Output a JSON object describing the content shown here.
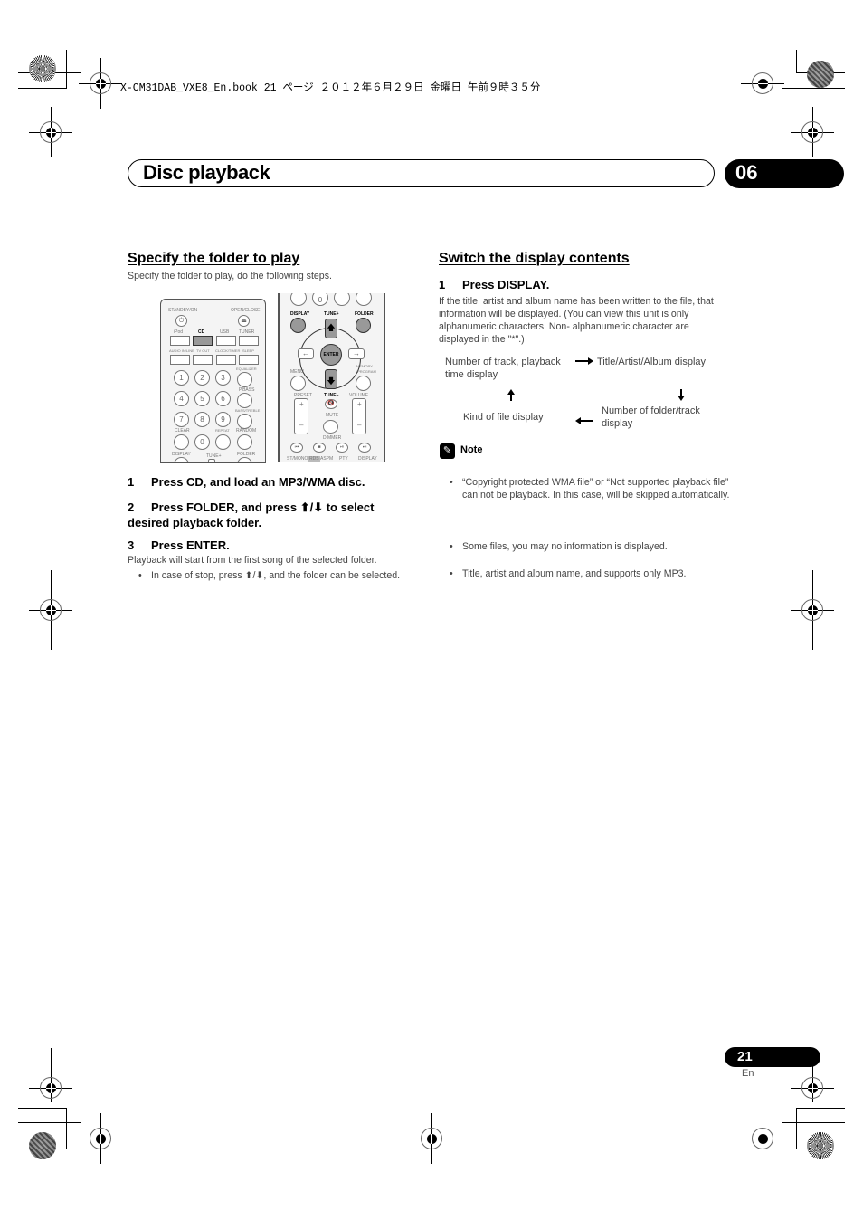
{
  "slug": "X-CM31DAB_VXE8_En.book  21 ページ  ２０１２年６月２９日  金曜日  午前９時３５分",
  "header": {
    "title": "Disc playback",
    "chapter": "06"
  },
  "left": {
    "heading": "Specify the folder to play",
    "intro": "Specify the folder to play, do the following steps.",
    "steps": [
      {
        "num": "1",
        "text": "Press CD, and load an MP3/WMA disc."
      },
      {
        "num": "2",
        "text": "Press FOLDER, and press ⬆/⬇ to select",
        "text2": "desired playback folder."
      },
      {
        "num": "3",
        "text": "Press ENTER."
      }
    ],
    "after_step3": "Playback will start from the first song of the selected folder.",
    "bullet": "In case of stop, press ⬆/⬇, and the folder can be selected."
  },
  "remote1": {
    "labels": {
      "standby": "STANDBY/ON",
      "open_close": "OPEN/CLOSE",
      "ipod": "iPod",
      "cd": "CD",
      "usb": "USB",
      "tuner": "TUNER",
      "audio_in": "AUDIO IN/LINE",
      "tv_out": "TV OUT",
      "clock": "CLOCK/TIMER",
      "sleep": "SLEEP",
      "equalizer": "EQUALIZER",
      "pbass": "P.BASS",
      "bass_treble": "BASS/TREBLE",
      "clear": "CLEAR",
      "repeat": "REPEAT",
      "random": "RANDOM",
      "display": "DISPLAY",
      "tune_plus": "TUNE+",
      "folder": "FOLDER"
    },
    "digits": [
      "1",
      "2",
      "3",
      "4",
      "5",
      "6",
      "7",
      "8",
      "9",
      "0"
    ]
  },
  "remote2": {
    "labels": {
      "zero": "0",
      "display": "DISPLAY",
      "tune_plus": "TUNE+",
      "folder": "FOLDER",
      "enter": "ENTER",
      "menu": "MENU",
      "memory": "MEMORY /PROGRAM",
      "tune_minus": "TUNE–",
      "preset": "PRESET",
      "volume": "VOLUME",
      "plus": "+",
      "minus": "–",
      "mute": "MUTE",
      "dimmer": "DIMMER",
      "st_mono": "ST/MONO",
      "rds": "RDS",
      "aspm": "ASPM",
      "pty": "PTY",
      "display2": "DISPLAY"
    }
  },
  "right": {
    "heading": "Switch the display contents",
    "step": {
      "num": "1",
      "text": "Press DISPLAY."
    },
    "para": "If the title, artist and album name has been written to the file, that information will be displayed. (You can view this unit is only alphanumeric characters. Non- alphanumeric character are displayed in the \"*\".)",
    "flow": {
      "a": "Number of track, playback time display",
      "b": "Title/Artist/Album display",
      "c": "Number of folder/track display",
      "d": "Kind of file display"
    },
    "note_title": "Note",
    "notes": [
      "“Copyright protected WMA file” or “Not supported playback file” can not be playback. In this case, will be skipped automatically.",
      "Some files, you may no information is displayed.",
      "Title, artist and album name, and supports only MP3."
    ]
  },
  "footer": {
    "page": "21",
    "lang": "En"
  }
}
